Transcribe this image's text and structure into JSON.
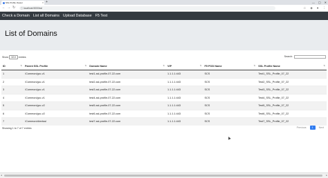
{
  "browser": {
    "tab_title": "SSL Profile Viewer",
    "url": "localhost:5000/ssl"
  },
  "nav": {
    "items": [
      "Check a Domain",
      "List all Domains",
      "Upload Database",
      "F5 Test"
    ]
  },
  "page": {
    "title": "List of Domains"
  },
  "controls": {
    "show_label": "Show",
    "entries_value": "10",
    "entries_label": "entries",
    "search_label": "Search:"
  },
  "table": {
    "headers": [
      "ID",
      "Parent SSL Profile",
      "Domain Name",
      "VIP",
      "F5 POD Name",
      "SSL Profile Name"
    ],
    "rows": [
      [
        "1",
        "/Common/gcc-v1",
        "test1-ssl-profile-07-22.com",
        "1.1.1.1:443",
        "SCS",
        "Test1_SSL_Profile_07_22"
      ],
      [
        "2",
        "/Common/gcc-v1",
        "test2-ssl-profile-07-22.com",
        "1.1.1.1:443",
        "SCS",
        "Test2_SSL_Profile_07_22"
      ],
      [
        "3",
        "/Common/gcc-v1",
        "test3-ssl-profile-07-22.com",
        "1.1.1.1:443",
        "SCS",
        "Test3_SSL_Profile_07_22"
      ],
      [
        "4",
        "/Common/gcc-v1",
        "test4-ssl-profile-07-22.com",
        "1.1.1.1:443",
        "SCS",
        "Test4_SSL_Profile_07_22"
      ],
      [
        "5",
        "/Common/gcc-v2",
        "test5-ssl-profile-07-22.com",
        "1.1.1.1:443",
        "SCS",
        "Test5_SSL_Profile_07_22"
      ],
      [
        "6",
        "/Common/gcc-v2",
        "test6-ssl-profile-07-22.com",
        "1.1.1.1:443",
        "SCS",
        "Test6_SSL_Profile_07_22"
      ],
      [
        "7",
        "/Common/clientssl",
        "test7-ssl-profile-07-22.com",
        "1.1.1.1:443",
        "SCS",
        "Test7_SSL_Profile_07_22"
      ]
    ]
  },
  "footer": {
    "info": "Showing 1 to 7 of 7 entries",
    "previous": "Previous",
    "page": "1",
    "next": "Next"
  },
  "colors": {
    "navbar": "#343a40",
    "jumbotron": "#e9ecef",
    "pager_active": "#2f7bf0"
  }
}
